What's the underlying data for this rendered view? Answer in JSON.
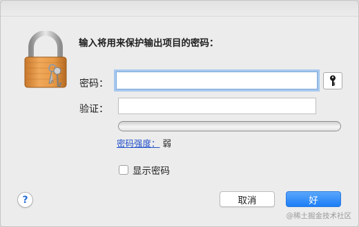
{
  "dialog": {
    "headline": "输入将用来保护输出项目的密码：",
    "password_label": "密码：",
    "verify_label": "验证：",
    "password_value": "",
    "verify_value": "",
    "strength_link": "密码强度：",
    "strength_value": "弱",
    "strength_fraction": 0.0,
    "show_password_label": "显示密码",
    "show_password_checked": false,
    "help_label": "?",
    "cancel_label": "取消",
    "ok_label": "好"
  },
  "watermark": "@稀土掘金技术社区",
  "colors": {
    "accent": "#1b7ef6",
    "link": "#1f4ec9",
    "focus_ring": "#a6c8ef"
  },
  "icons": [
    "padlock-keys-icon",
    "key-icon",
    "help-icon"
  ]
}
